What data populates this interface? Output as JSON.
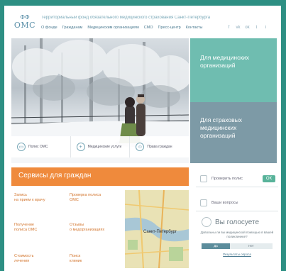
{
  "header": {
    "logo_emblem": "ФФ",
    "logo_text": "ОМС",
    "tagline": "Территориальный фонд обязательного медицинского страхования Санкт-Петербурга",
    "nav": [
      "О фонде",
      "Гражданам",
      "Медицинским организациям",
      "СМО",
      "Пресс-центр",
      "Контакты"
    ],
    "social": [
      "f",
      "vk",
      "ok",
      "t",
      "i"
    ]
  },
  "hero": {
    "features": [
      {
        "label": "Полис ОМС",
        "icon": "card-icon"
      },
      {
        "label": "Медицинские услуги",
        "icon": "medical-icon"
      },
      {
        "label": "Права граждан",
        "icon": "people-icon"
      }
    ]
  },
  "side": {
    "med_org": "Для медицинских организаций",
    "ins_org": "Для страховых медицинских организаций"
  },
  "services": {
    "title": "Сервисы для граждан",
    "items": [
      [
        "Запись",
        "на прием к врачу"
      ],
      [
        "Проверка полиса",
        "ОМС"
      ],
      [
        "Получение",
        "полиса ОМС"
      ],
      [
        "Отзывы",
        "о медорганизациях"
      ],
      [
        "Стоимость",
        "лечения"
      ],
      [
        "Поиск",
        "клиник"
      ]
    ]
  },
  "map": {
    "city": "Санкт-Петербург"
  },
  "widgets": {
    "check_label": "Проверить полис",
    "ok_label": "ОК",
    "questions_label": "Ваши вопросы"
  },
  "poll": {
    "title": "Вы голосуете",
    "question": "Довольны ли вы медицинской помощью в вашей поликлинике?",
    "option_a": "Да",
    "option_b": "Нет",
    "share_a": 0.4,
    "share_b": 0.6,
    "results_link": "Результаты опроса"
  },
  "colors": {
    "frame": "#2d8f83",
    "teal": "#6fbdb0",
    "slate": "#7d9aa6",
    "orange": "#ef8a3c"
  }
}
